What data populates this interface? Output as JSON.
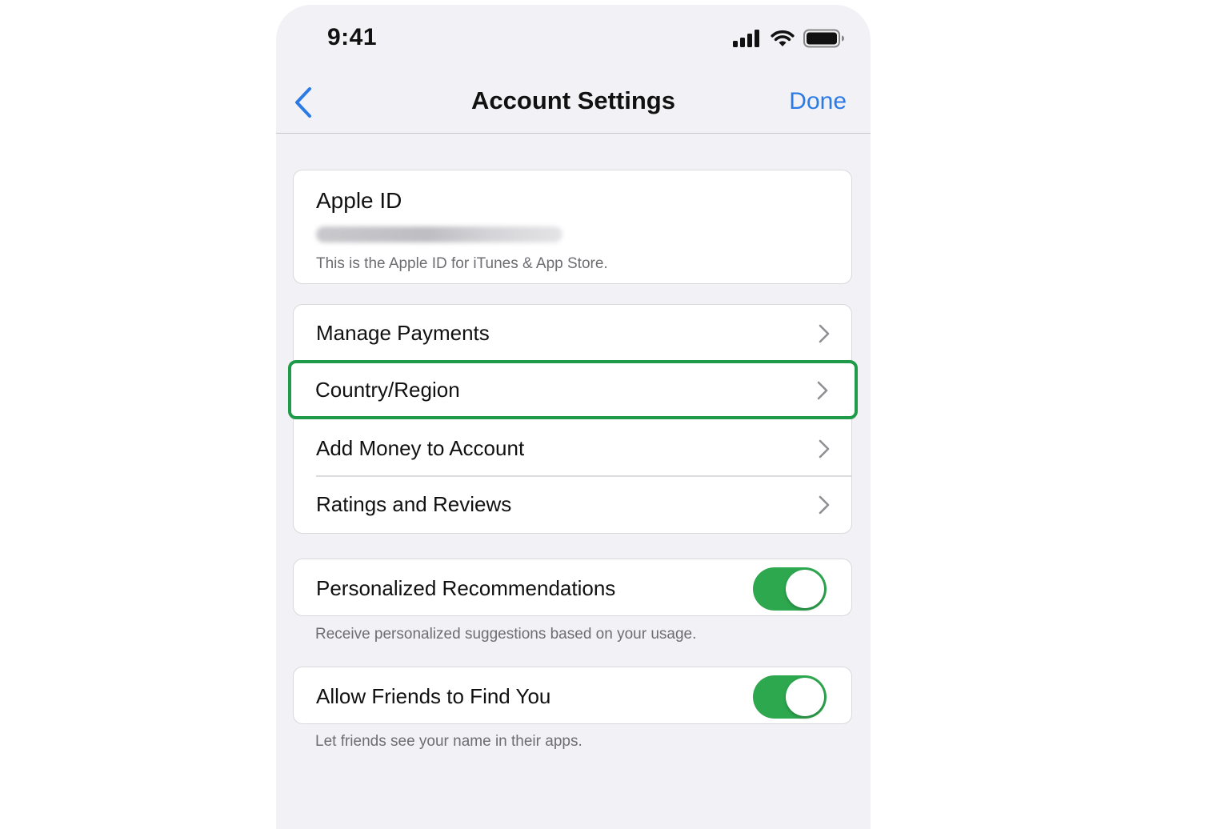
{
  "status_bar": {
    "time": "9:41",
    "icons": [
      "cellular-signal-icon",
      "wifi-icon",
      "battery-icon"
    ]
  },
  "nav": {
    "back_icon": "chevron-left-icon",
    "title": "Account Settings",
    "done_label": "Done"
  },
  "apple_id": {
    "title": "Apple ID",
    "email": "",
    "note": "This is the Apple ID for iTunes & App Store."
  },
  "menu": {
    "items": [
      {
        "label": "Manage Payments"
      },
      {
        "label": "Country/Region",
        "highlighted": true
      },
      {
        "label": "Add Money to Account"
      },
      {
        "label": "Ratings and Reviews"
      }
    ]
  },
  "toggles": [
    {
      "label": "Personalized Recommendations",
      "on": true,
      "footnote": "Receive personalized suggestions based on your usage."
    },
    {
      "label": "Allow Friends to Find You",
      "on": true,
      "footnote": "Let friends see your name in their apps."
    }
  ],
  "colors": {
    "accent": "#2c7be5",
    "toggle_on": "#2ea84f",
    "highlight": "#1f9a48",
    "background": "#f2f2f6"
  }
}
